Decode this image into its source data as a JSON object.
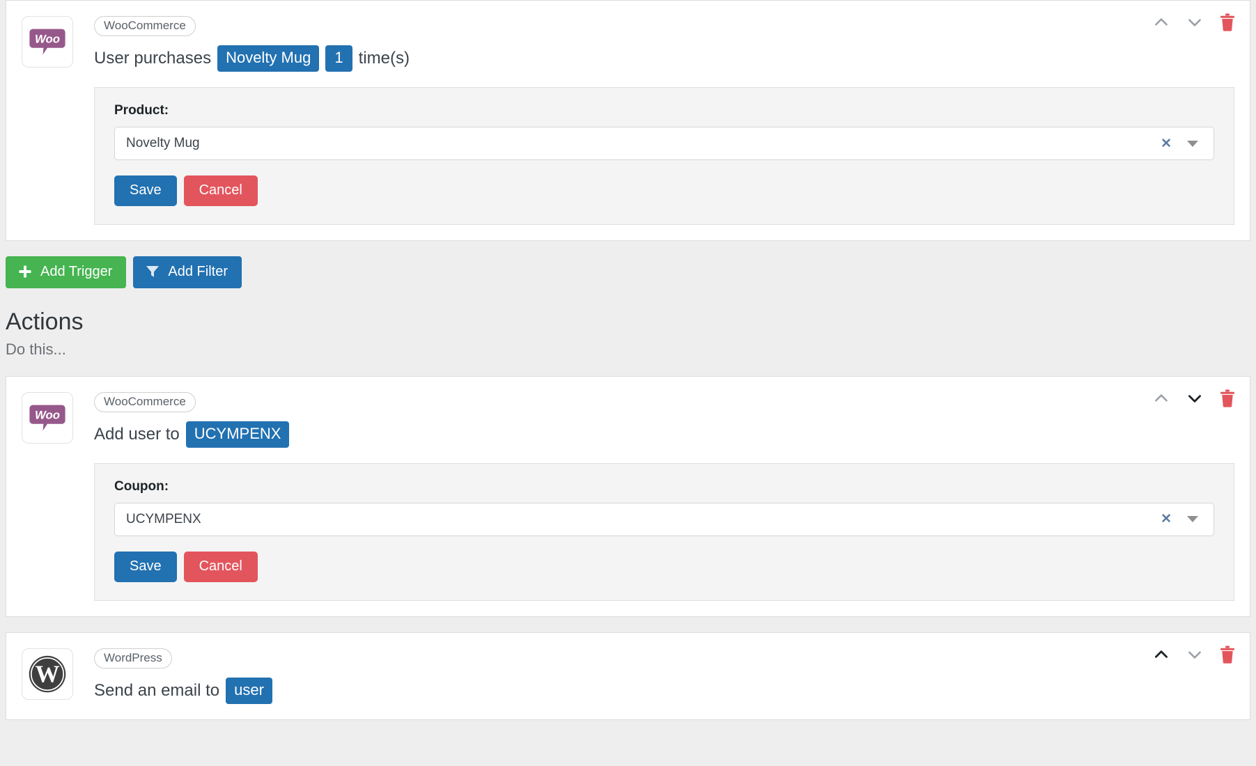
{
  "trigger_card": {
    "integration_badge": "WooCommerce",
    "integration_icon": "woocommerce-logo",
    "sentence": {
      "prefix": "User purchases",
      "token_product": "Novelty Mug",
      "token_count": "1",
      "suffix": "time(s)"
    },
    "actions": {
      "move_up_icon": "chevron-up-icon",
      "move_down_icon": "chevron-down-icon",
      "delete_icon": "trash-icon"
    },
    "field": {
      "label": "Product:",
      "value": "Novelty Mug",
      "clear_icon": "clear-x-icon",
      "dropdown_icon": "caret-down-icon"
    },
    "buttons": {
      "save": "Save",
      "cancel": "Cancel"
    }
  },
  "add_bar": {
    "add_trigger": "Add Trigger",
    "add_trigger_icon": "plus-icon",
    "add_filter": "Add Filter",
    "add_filter_icon": "funnel-icon"
  },
  "actions_section": {
    "title": "Actions",
    "subtitle": "Do this..."
  },
  "action_card_1": {
    "integration_badge": "WooCommerce",
    "integration_icon": "woocommerce-logo",
    "sentence": {
      "prefix": "Add user to",
      "token_coupon": "UCYMPENX"
    },
    "actions": {
      "move_up_icon": "chevron-up-icon",
      "move_down_icon": "chevron-down-icon",
      "delete_icon": "trash-icon"
    },
    "field": {
      "label": "Coupon:",
      "value": "UCYMPENX",
      "clear_icon": "clear-x-icon",
      "dropdown_icon": "caret-down-icon"
    },
    "buttons": {
      "save": "Save",
      "cancel": "Cancel"
    }
  },
  "action_card_2": {
    "integration_badge": "WordPress",
    "integration_icon": "wordpress-logo",
    "sentence": {
      "prefix": "Send an email to",
      "token_recipient": "user"
    },
    "actions": {
      "move_up_icon": "chevron-up-icon",
      "move_down_icon": "chevron-down-icon",
      "delete_icon": "trash-icon"
    }
  },
  "colors": {
    "token_blue": "#2271b1",
    "save_blue": "#2271b1",
    "cancel_red": "#e3555c",
    "trigger_green": "#46b450",
    "trash_red": "#e3555c",
    "woo_purple": "#96588a",
    "page_bg": "#eeeeee"
  }
}
